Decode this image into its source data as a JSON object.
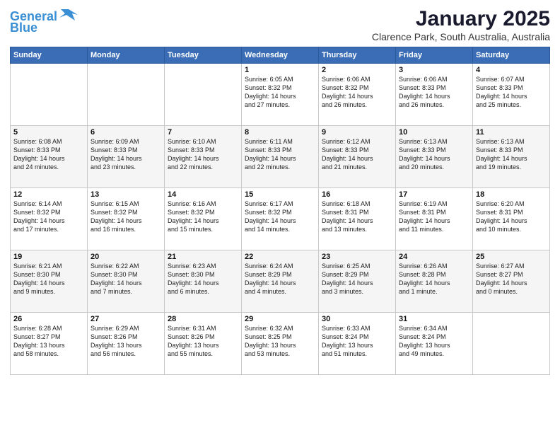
{
  "logo": {
    "line1": "General",
    "line2": "Blue"
  },
  "title": "January 2025",
  "subtitle": "Clarence Park, South Australia, Australia",
  "weekdays": [
    "Sunday",
    "Monday",
    "Tuesday",
    "Wednesday",
    "Thursday",
    "Friday",
    "Saturday"
  ],
  "weeks": [
    [
      {
        "day": "",
        "info": ""
      },
      {
        "day": "",
        "info": ""
      },
      {
        "day": "",
        "info": ""
      },
      {
        "day": "1",
        "info": "Sunrise: 6:05 AM\nSunset: 8:32 PM\nDaylight: 14 hours\nand 27 minutes."
      },
      {
        "day": "2",
        "info": "Sunrise: 6:06 AM\nSunset: 8:32 PM\nDaylight: 14 hours\nand 26 minutes."
      },
      {
        "day": "3",
        "info": "Sunrise: 6:06 AM\nSunset: 8:33 PM\nDaylight: 14 hours\nand 26 minutes."
      },
      {
        "day": "4",
        "info": "Sunrise: 6:07 AM\nSunset: 8:33 PM\nDaylight: 14 hours\nand 25 minutes."
      }
    ],
    [
      {
        "day": "5",
        "info": "Sunrise: 6:08 AM\nSunset: 8:33 PM\nDaylight: 14 hours\nand 24 minutes."
      },
      {
        "day": "6",
        "info": "Sunrise: 6:09 AM\nSunset: 8:33 PM\nDaylight: 14 hours\nand 23 minutes."
      },
      {
        "day": "7",
        "info": "Sunrise: 6:10 AM\nSunset: 8:33 PM\nDaylight: 14 hours\nand 22 minutes."
      },
      {
        "day": "8",
        "info": "Sunrise: 6:11 AM\nSunset: 8:33 PM\nDaylight: 14 hours\nand 22 minutes."
      },
      {
        "day": "9",
        "info": "Sunrise: 6:12 AM\nSunset: 8:33 PM\nDaylight: 14 hours\nand 21 minutes."
      },
      {
        "day": "10",
        "info": "Sunrise: 6:13 AM\nSunset: 8:33 PM\nDaylight: 14 hours\nand 20 minutes."
      },
      {
        "day": "11",
        "info": "Sunrise: 6:13 AM\nSunset: 8:33 PM\nDaylight: 14 hours\nand 19 minutes."
      }
    ],
    [
      {
        "day": "12",
        "info": "Sunrise: 6:14 AM\nSunset: 8:32 PM\nDaylight: 14 hours\nand 17 minutes."
      },
      {
        "day": "13",
        "info": "Sunrise: 6:15 AM\nSunset: 8:32 PM\nDaylight: 14 hours\nand 16 minutes."
      },
      {
        "day": "14",
        "info": "Sunrise: 6:16 AM\nSunset: 8:32 PM\nDaylight: 14 hours\nand 15 minutes."
      },
      {
        "day": "15",
        "info": "Sunrise: 6:17 AM\nSunset: 8:32 PM\nDaylight: 14 hours\nand 14 minutes."
      },
      {
        "day": "16",
        "info": "Sunrise: 6:18 AM\nSunset: 8:31 PM\nDaylight: 14 hours\nand 13 minutes."
      },
      {
        "day": "17",
        "info": "Sunrise: 6:19 AM\nSunset: 8:31 PM\nDaylight: 14 hours\nand 11 minutes."
      },
      {
        "day": "18",
        "info": "Sunrise: 6:20 AM\nSunset: 8:31 PM\nDaylight: 14 hours\nand 10 minutes."
      }
    ],
    [
      {
        "day": "19",
        "info": "Sunrise: 6:21 AM\nSunset: 8:30 PM\nDaylight: 14 hours\nand 9 minutes."
      },
      {
        "day": "20",
        "info": "Sunrise: 6:22 AM\nSunset: 8:30 PM\nDaylight: 14 hours\nand 7 minutes."
      },
      {
        "day": "21",
        "info": "Sunrise: 6:23 AM\nSunset: 8:30 PM\nDaylight: 14 hours\nand 6 minutes."
      },
      {
        "day": "22",
        "info": "Sunrise: 6:24 AM\nSunset: 8:29 PM\nDaylight: 14 hours\nand 4 minutes."
      },
      {
        "day": "23",
        "info": "Sunrise: 6:25 AM\nSunset: 8:29 PM\nDaylight: 14 hours\nand 3 minutes."
      },
      {
        "day": "24",
        "info": "Sunrise: 6:26 AM\nSunset: 8:28 PM\nDaylight: 14 hours\nand 1 minute."
      },
      {
        "day": "25",
        "info": "Sunrise: 6:27 AM\nSunset: 8:27 PM\nDaylight: 14 hours\nand 0 minutes."
      }
    ],
    [
      {
        "day": "26",
        "info": "Sunrise: 6:28 AM\nSunset: 8:27 PM\nDaylight: 13 hours\nand 58 minutes."
      },
      {
        "day": "27",
        "info": "Sunrise: 6:29 AM\nSunset: 8:26 PM\nDaylight: 13 hours\nand 56 minutes."
      },
      {
        "day": "28",
        "info": "Sunrise: 6:31 AM\nSunset: 8:26 PM\nDaylight: 13 hours\nand 55 minutes."
      },
      {
        "day": "29",
        "info": "Sunrise: 6:32 AM\nSunset: 8:25 PM\nDaylight: 13 hours\nand 53 minutes."
      },
      {
        "day": "30",
        "info": "Sunrise: 6:33 AM\nSunset: 8:24 PM\nDaylight: 13 hours\nand 51 minutes."
      },
      {
        "day": "31",
        "info": "Sunrise: 6:34 AM\nSunset: 8:24 PM\nDaylight: 13 hours\nand 49 minutes."
      },
      {
        "day": "",
        "info": ""
      }
    ]
  ]
}
